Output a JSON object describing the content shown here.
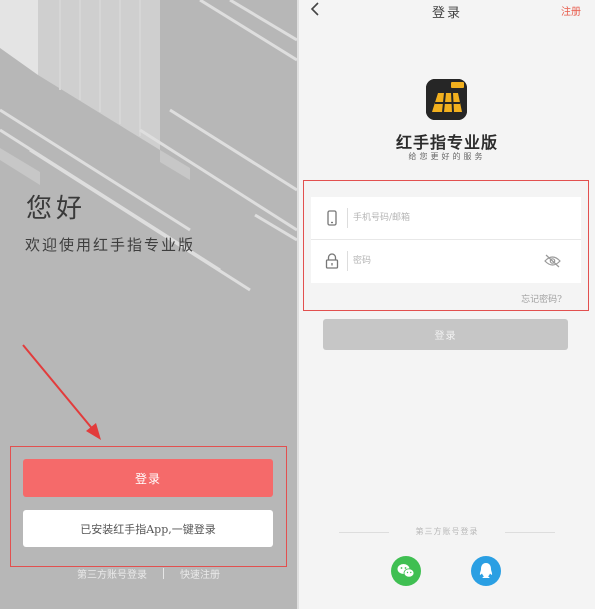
{
  "left": {
    "greeting_title": "您好",
    "greeting_subtitle": "欢迎使用红手指专业版",
    "login_button": "登录",
    "oneclick_login_button": "已安装红手指App,一键登录",
    "third_party_login": "第三方账号登录",
    "quick_register": "快速注册"
  },
  "right": {
    "nav": {
      "back_icon": "chevron-left-icon",
      "title": "登录",
      "register": "注册"
    },
    "app": {
      "name": "红手指专业版",
      "slogan": "给您更好的服务",
      "logo_icon": "red-finger-logo"
    },
    "form": {
      "phone_placeholder": "手机号码/邮箱",
      "password_placeholder": "密码",
      "phone_icon": "phone-icon",
      "password_icon": "lock-icon",
      "visibility_icon": "eye-hidden-icon"
    },
    "forgot_password": "忘记密码?",
    "submit_button": "登录",
    "third_party_label": "第三方账号登录",
    "social": [
      {
        "name": "wechat",
        "icon": "wechat-icon",
        "color": "#3fbf52"
      },
      {
        "name": "qq",
        "icon": "qq-icon",
        "color": "#2a9fe3"
      }
    ]
  },
  "colors": {
    "accent_red": "#f56a6a",
    "highlight_border": "#e2504f",
    "register_red": "#e85a4a",
    "left_background": "#b7b7b7",
    "disabled_button": "#c6c6c6"
  }
}
